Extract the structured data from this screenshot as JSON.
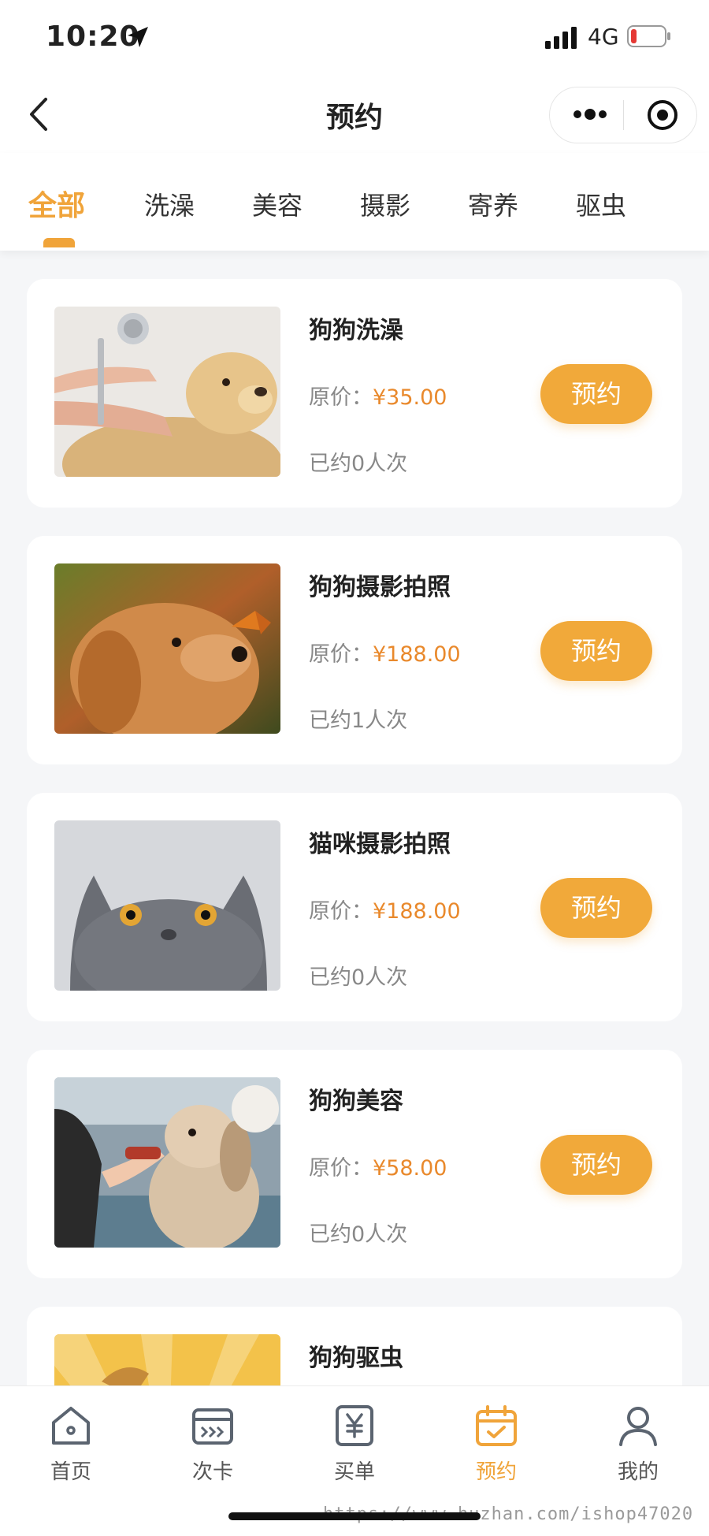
{
  "status_bar": {
    "time": "10:20",
    "network": "4G"
  },
  "nav": {
    "title": "预约"
  },
  "tabs": [
    {
      "label": "全部"
    },
    {
      "label": "洗澡"
    },
    {
      "label": "美容"
    },
    {
      "label": "摄影"
    },
    {
      "label": "寄养"
    },
    {
      "label": "驱虫"
    }
  ],
  "services": [
    {
      "name": "狗狗洗澡",
      "price_label": "原价：",
      "price": "¥35.00",
      "booked": "已约0人次",
      "button": "预约"
    },
    {
      "name": "狗狗摄影拍照",
      "price_label": "原价：",
      "price": "¥188.00",
      "booked": "已约1人次",
      "button": "预约"
    },
    {
      "name": "猫咪摄影拍照",
      "price_label": "原价：",
      "price": "¥188.00",
      "booked": "已约0人次",
      "button": "预约"
    },
    {
      "name": "狗狗美容",
      "price_label": "原价：",
      "price": "¥58.00",
      "booked": "已约0人次",
      "button": "预约"
    },
    {
      "name": "狗狗驱虫"
    }
  ],
  "tabbar": [
    {
      "label": "首页",
      "icon": "home-icon"
    },
    {
      "label": "次卡",
      "icon": "card-icon"
    },
    {
      "label": "买单",
      "icon": "pay-icon"
    },
    {
      "label": "预约",
      "icon": "calendar-icon"
    },
    {
      "label": "我的",
      "icon": "user-icon"
    }
  ],
  "watermark": "https://www.huzhan.com/ishop47020",
  "colors": {
    "accent": "#f0a43a",
    "price": "#e9892c",
    "background": "#f5f6f8"
  }
}
